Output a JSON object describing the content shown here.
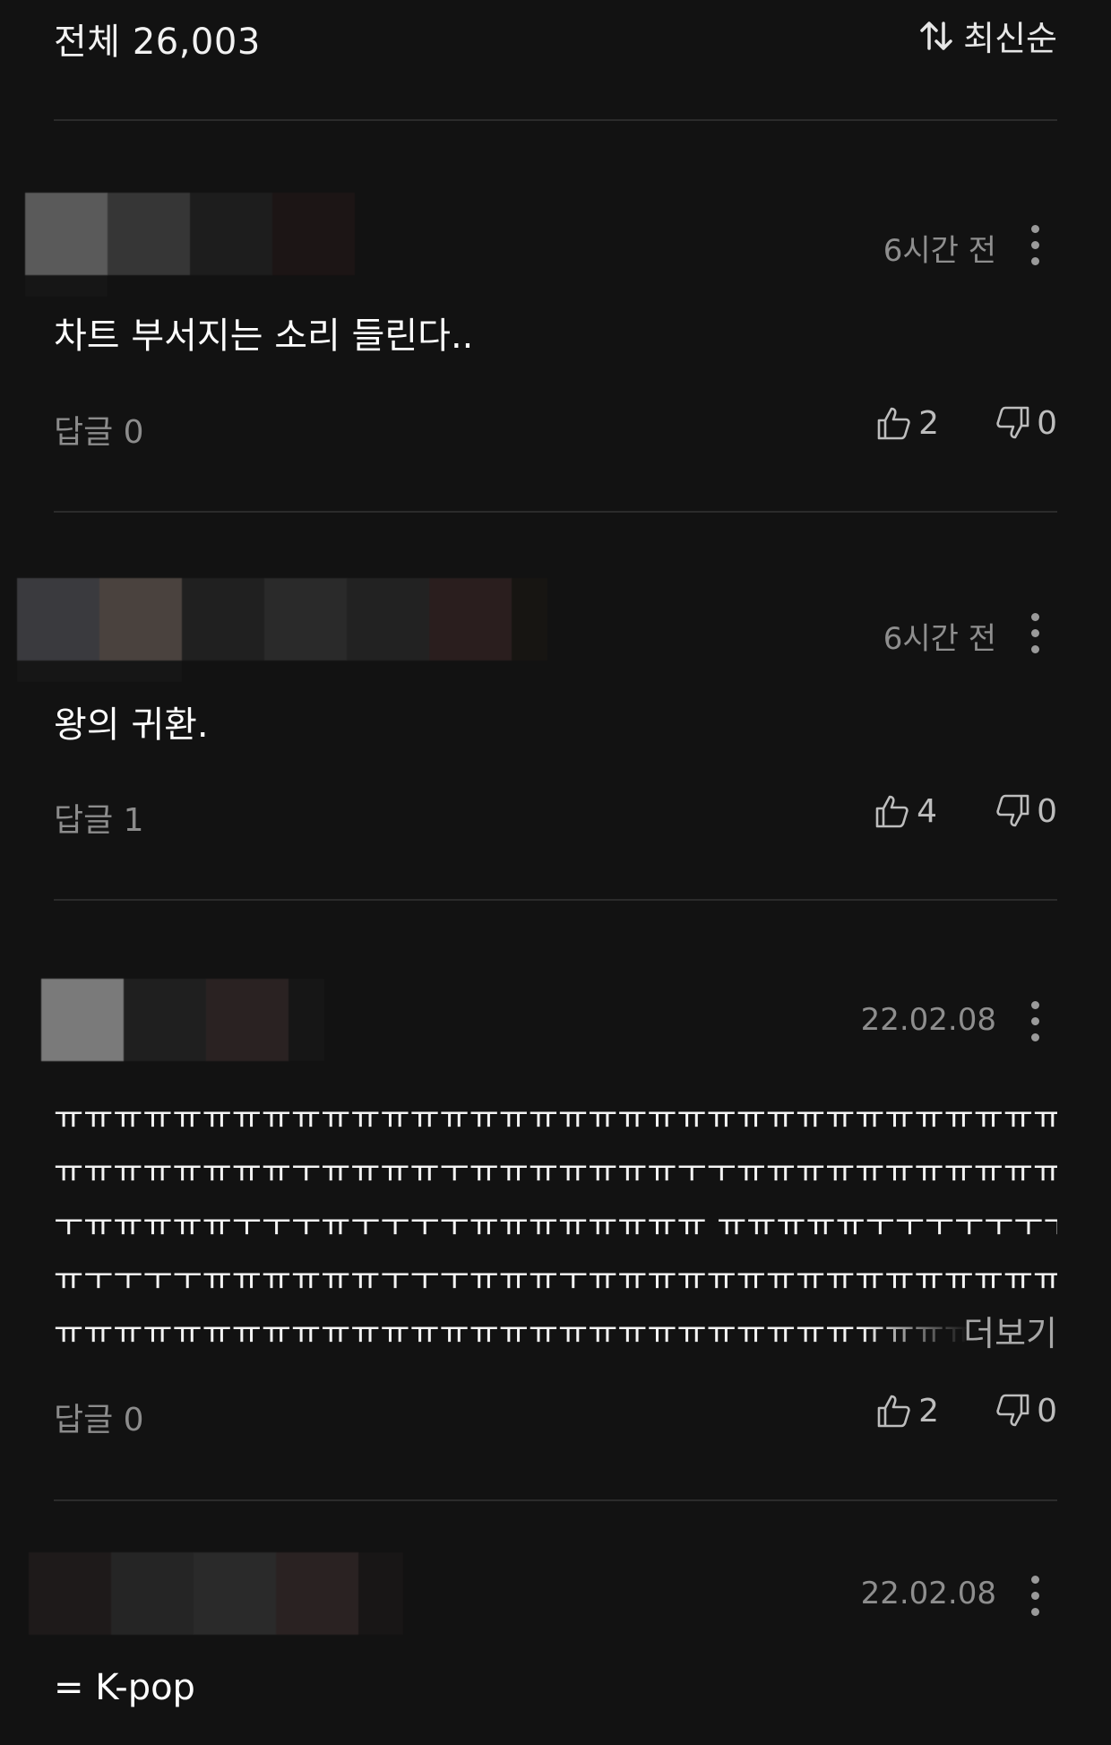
{
  "header": {
    "total_label": "전체 26,003",
    "sort_label": "최신순",
    "sort_icon": "sort-arrows-icon"
  },
  "comments": [
    {
      "time": "6시간 전",
      "text": "차트 부서지는 소리 들린다..",
      "reply_label": "답글 0",
      "likes": "2",
      "dislikes": "0",
      "avatar_colors": [
        "#5a5a5a",
        "#363636",
        "#1d1d1d",
        "#1c1515"
      ]
    },
    {
      "time": "6시간 전",
      "text": "왕의 귀환.",
      "reply_label": "답글 1",
      "likes": "4",
      "dislikes": "0",
      "avatar_colors": [
        "#3a3a3e",
        "#4a423e",
        "#202020",
        "#2a2a2a",
        "#222222",
        "#2a1e1e",
        "#171512"
      ]
    },
    {
      "time": "22.02.08",
      "text_lines": [
        "ㅠㅠㅠㅠㅠㅠㅠㅠㅠㅠㅠㅠㅠㅠㅠㅠㅠㅠㅠㅠㅠㅠㅠㅠㅠㅠㅠㅠㅠㅠㅠㅠㅠㅠㅠㅠㅠㅠㅠㅠ",
        "ㅠㅠㅠㅠㅠㅠㅠㅠㅜㅠㅠㅠㅠㅜㅠㅠㅠㅠㅠㅠㅠㅜㅜㅠㅠㅠㅠㅠㅠㅠㅠㅠㅠㅠㅠㅠㅠㅠㅠㅜ",
        "ㅜㅠㅠㅠㅠㅠㅜㅜㅜㅠㅜㅜㅜㅜㅠㅠㅠㅠㅠㅠㅠㅠ  ㅠㅠㅠㅠㅠㅜㅜㅜㅜㅜㅜㅜㅜㅜㅜㅜㅜ",
        "ㅠㅜㅜㅜㅜㅠㅠㅠㅠㅠㅠㅜㅜㅜㅠㅠㅠㅜㅠㅠㅠㅠㅠㅠㅠㅠㅠㅠㅠㅠㅠㅠㅠㅠㅠㅠㅠㅠㅠㅠ",
        "ㅠㅠㅠㅠㅠㅠㅠㅠㅠㅠㅠㅠㅠㅠㅠㅠㅠㅠㅠㅠㅠㅠㅠㅠㅠㅠㅠㅠㅠㅠㅠㅠㅜㅠㅠㅠㅠㅜ"
      ],
      "more_label": "더보기",
      "reply_label": "답글 0",
      "likes": "2",
      "dislikes": "0",
      "avatar_colors": [
        "#7a7a7a",
        "#1f1f1f",
        "#2a2222",
        "#161616"
      ]
    },
    {
      "time": "22.02.08",
      "text": "= K-pop",
      "avatar_colors": [
        "#1e1a1a",
        "#252525",
        "#2a2a2a",
        "#2a2222",
        "#181616"
      ]
    }
  ]
}
